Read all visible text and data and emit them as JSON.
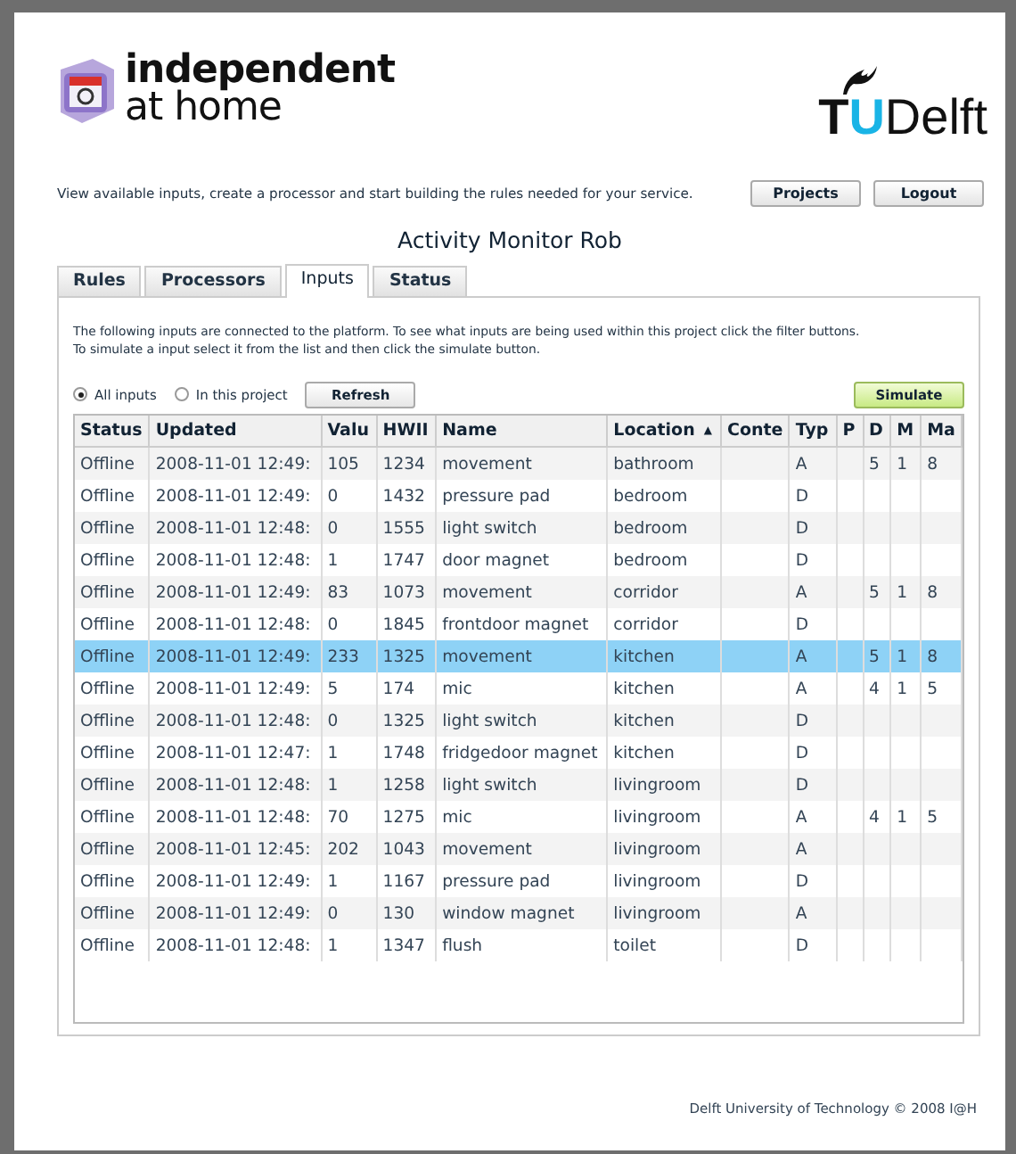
{
  "header": {
    "logo_lines": [
      "independent",
      "at home"
    ],
    "partner_logo": [
      "T",
      "U",
      "Delft"
    ]
  },
  "intro": "View available inputs, create a processor and start building the rules needed for your service.",
  "nav_buttons": [
    "Projects",
    "Logout"
  ],
  "title": "Activity Monitor Rob",
  "tabs": [
    {
      "label": "Rules",
      "selected": false
    },
    {
      "label": "Processors",
      "selected": false
    },
    {
      "label": "Inputs",
      "selected": true
    },
    {
      "label": "Status",
      "selected": false
    }
  ],
  "description": [
    "The following inputs are connected to the platform. To see what inputs are being used within this project click the filter buttons.",
    "To simulate a input select it from the list and then click the simulate button."
  ],
  "filters": [
    {
      "label": "All inputs",
      "selected": true
    },
    {
      "label": "In this project",
      "selected": false
    }
  ],
  "refresh_button": "Refresh",
  "simulate_button": "Simulate",
  "table": {
    "columns": [
      {
        "label": "Status"
      },
      {
        "label": "Updated"
      },
      {
        "label": "Valu"
      },
      {
        "label": "HWII"
      },
      {
        "label": "Name"
      },
      {
        "label": "Location",
        "sort_mark": "▲"
      },
      {
        "label": "Conte"
      },
      {
        "label": "Typ"
      },
      {
        "label": "P"
      },
      {
        "label": "D"
      },
      {
        "label": "M"
      },
      {
        "label": "Ma"
      }
    ],
    "rows": [
      {
        "selected": false,
        "cells": [
          "Offline",
          "2008-11-01 12:49:",
          "105",
          "1234",
          "movement",
          "bathroom",
          null,
          "A",
          null,
          "5",
          "1",
          "8"
        ]
      },
      {
        "selected": false,
        "cells": [
          "Offline",
          "2008-11-01 12:49:",
          "0",
          "1432",
          "pressure pad",
          "bedroom",
          null,
          "D",
          null,
          null,
          null,
          null
        ]
      },
      {
        "selected": false,
        "cells": [
          "Offline",
          "2008-11-01 12:48:",
          "0",
          "1555",
          "light switch",
          "bedroom",
          null,
          "D",
          null,
          null,
          null,
          null
        ]
      },
      {
        "selected": false,
        "cells": [
          "Offline",
          "2008-11-01 12:48:",
          "1",
          "1747",
          "door magnet",
          "bedroom",
          null,
          "D",
          null,
          null,
          null,
          null
        ]
      },
      {
        "selected": false,
        "cells": [
          "Offline",
          "2008-11-01 12:49:",
          "83",
          "1073",
          "movement",
          "corridor",
          null,
          "A",
          null,
          "5",
          "1",
          "8"
        ]
      },
      {
        "selected": false,
        "cells": [
          "Offline",
          "2008-11-01 12:48:",
          "0",
          "1845",
          "frontdoor magnet",
          "corridor",
          null,
          "D",
          null,
          null,
          null,
          null
        ]
      },
      {
        "selected": true,
        "cells": [
          "Offline",
          "2008-11-01 12:49:",
          "233",
          "1325",
          "movement",
          "kitchen",
          null,
          "A",
          null,
          "5",
          "1",
          "8"
        ]
      },
      {
        "selected": false,
        "cells": [
          "Offline",
          "2008-11-01 12:49:",
          "5",
          "174",
          "mic",
          "kitchen",
          null,
          "A",
          null,
          "4",
          "1",
          "5"
        ]
      },
      {
        "selected": false,
        "cells": [
          "Offline",
          "2008-11-01 12:48:",
          "0",
          "1325",
          "light switch",
          "kitchen",
          null,
          "D",
          null,
          null,
          null,
          null
        ]
      },
      {
        "selected": false,
        "cells": [
          "Offline",
          "2008-11-01 12:47:",
          "1",
          "1748",
          "fridgedoor magnet",
          "kitchen",
          null,
          "D",
          null,
          null,
          null,
          null
        ]
      },
      {
        "selected": false,
        "cells": [
          "Offline",
          "2008-11-01 12:48:",
          "1",
          "1258",
          "light switch",
          "livingroom",
          null,
          "D",
          null,
          null,
          null,
          null
        ]
      },
      {
        "selected": false,
        "cells": [
          "Offline",
          "2008-11-01 12:48:",
          "70",
          "1275",
          "mic",
          "livingroom",
          null,
          "A",
          null,
          "4",
          "1",
          "5"
        ]
      },
      {
        "selected": false,
        "cells": [
          "Offline",
          "2008-11-01 12:45:",
          "202",
          "1043",
          "movement",
          "livingroom",
          null,
          "A",
          null,
          null,
          null,
          null
        ]
      },
      {
        "selected": false,
        "cells": [
          "Offline",
          "2008-11-01 12:49:",
          "1",
          "1167",
          "pressure pad",
          "livingroom",
          null,
          "D",
          null,
          null,
          null,
          null
        ]
      },
      {
        "selected": false,
        "cells": [
          "Offline",
          "2008-11-01 12:49:",
          "0",
          "130",
          "window magnet",
          "livingroom",
          null,
          "A",
          null,
          null,
          null,
          null
        ]
      },
      {
        "selected": false,
        "cells": [
          "Offline",
          "2008-11-01 12:48:",
          "1",
          "1347",
          "flush",
          "toilet",
          null,
          "D",
          null,
          null,
          null,
          null
        ]
      }
    ]
  },
  "footer": "Delft University of Technology © 2008 I@H"
}
